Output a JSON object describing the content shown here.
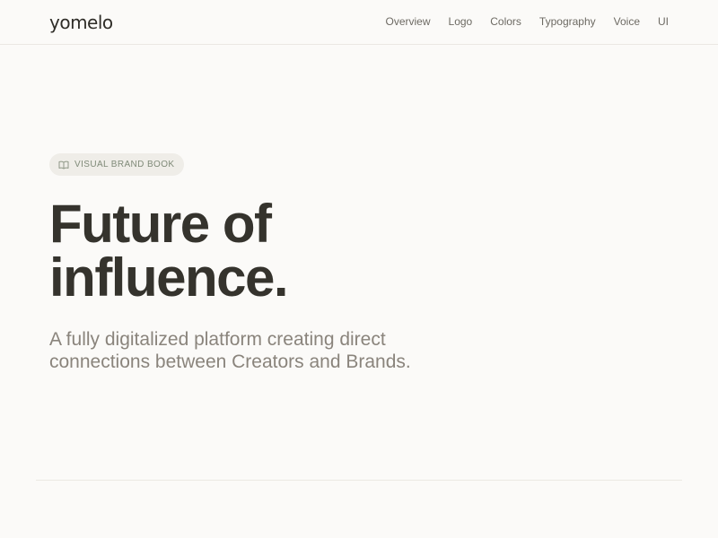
{
  "header": {
    "logo": "yomelo",
    "nav": [
      "Overview",
      "Logo",
      "Colors",
      "Typography",
      "Voice",
      "UI"
    ]
  },
  "hero": {
    "badge": {
      "icon": "book-open-icon",
      "label": "VISUAL BRAND BOOK"
    },
    "title_lines": [
      "Future of",
      "influence."
    ],
    "subtitle_lines": [
      "A fully digitalized platform creating direct",
      "connections between Creators and Brands."
    ]
  },
  "colors": {
    "background": "#fbfaf8",
    "text": "#35332d",
    "muted": "#8a847c",
    "badge_bg": "#efede8",
    "badge_text": "#7f8a78"
  }
}
